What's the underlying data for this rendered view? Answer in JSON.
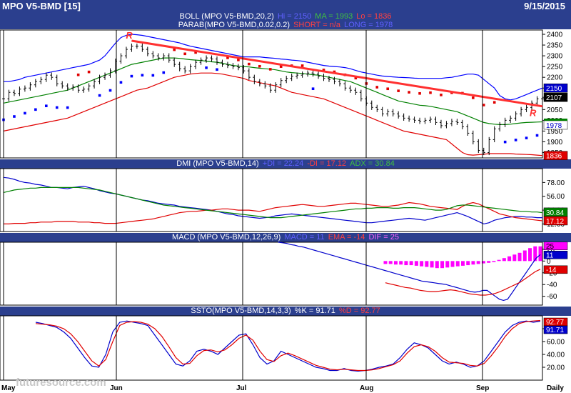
{
  "header": {
    "symbol": "MPO V5-BMD [15]",
    "date": "9/15/2015"
  },
  "panels": {
    "price": {
      "boll_label": "BOLL (MPO V5-BMD,20,2)",
      "boll_hi": "Hi = 2150",
      "boll_ma": "MA = 1993",
      "boll_lo": "Lo = 1836",
      "parab_label": "PARAB(MPO V5-BMD,0.02,0.2)",
      "parab_short": "SHORT = n/a",
      "parab_long": "LONG = 1978",
      "yticks": [
        "2400",
        "2350",
        "2300",
        "2250",
        "2200",
        "2150",
        "2100",
        "2050",
        "2000",
        "1950",
        "1900",
        "1850"
      ],
      "last_labels": {
        "hi": "2150",
        "close": "2107",
        "ma": "1978",
        "lo": "1836"
      },
      "annotations": [
        "R",
        "R"
      ]
    },
    "dmi": {
      "label": "DMI (MPO V5-BMD,14)",
      "plus": "+DI = 22.24",
      "minus": "-DI = 17.12",
      "adx": "ADX = 30.84",
      "yticks": [
        "78.00",
        "56.00",
        "34.00",
        "12.00"
      ],
      "last_labels": {
        "adx": "30.84",
        "minus": "17.12"
      }
    },
    "macd": {
      "label": "MACD (MPO V5-BMD,12,26,9)",
      "macd": "MACD = 11",
      "ema": "EMA = -14",
      "dif": "DIF = 25",
      "yticks": [
        "20",
        "0",
        "-20",
        "-40",
        "-60"
      ],
      "last_labels": {
        "dif": "25",
        "macd": "11",
        "ema": "-14"
      }
    },
    "ssto": {
      "label": "SSTO(MPO V5-BMD,14,3,3)",
      "k": "%K = 91.71",
      "d": "%D = 92.77",
      "yticks": [
        "80.00",
        "60.00",
        "40.00",
        "20.00"
      ],
      "last_labels": {
        "d": "92.77",
        "k": "91.71"
      }
    }
  },
  "xaxis": {
    "labels": [
      "May",
      "Jun",
      "Jul",
      "Aug",
      "Sep",
      "Daily"
    ]
  },
  "watermark": "futuresource.com",
  "colors": {
    "header": "#2b3f8e",
    "bollUpper": "#0000ff",
    "bollLower": "#e00000",
    "bollMA": "#008000",
    "sarLong": "#0000ff",
    "sarShort": "#e00000",
    "trendline": "#ff3030",
    "bars": "#000000",
    "macdHist": "#ff00ff"
  },
  "chart_data": [
    {
      "type": "line",
      "panel": "price",
      "ylim": [
        1825,
        2420
      ],
      "note_series": [
        "Close",
        "BOLL Hi",
        "BOLL MA",
        "BOLL Lo"
      ],
      "xlabels": [
        "May",
        "Jun",
        "Jul",
        "Aug",
        "Sep"
      ],
      "close": [
        2100,
        2130,
        2125,
        2145,
        2150,
        2165,
        2180,
        2190,
        2210,
        2200,
        2170,
        2160,
        2150,
        2155,
        2140,
        2145,
        2160,
        2180,
        2200,
        2210,
        2230,
        2275,
        2300,
        2330,
        2345,
        2345,
        2330,
        2310,
        2300,
        2290,
        2300,
        2280,
        2260,
        2240,
        2230,
        2250,
        2270,
        2280,
        2290,
        2285,
        2270,
        2260,
        2255,
        2250,
        2245,
        2230,
        2200,
        2180,
        2170,
        2160,
        2140,
        2165,
        2185,
        2195,
        2205,
        2210,
        2215,
        2220,
        2215,
        2205,
        2195,
        2190,
        2180,
        2170,
        2150,
        2140,
        2130,
        2100,
        2080,
        2060,
        2050,
        2030,
        2040,
        2030,
        2020,
        2010,
        2005,
        2000,
        1995,
        2000,
        2005,
        1990,
        1975,
        1985,
        1995,
        1990,
        1970,
        1940,
        1900,
        1860,
        1850,
        1910,
        1960,
        1980,
        2000,
        2010,
        2030,
        2050,
        2060,
        2080,
        2100,
        2107
      ],
      "bollHi": [
        2180,
        2180,
        2185,
        2190,
        2200,
        2205,
        2210,
        2215,
        2220,
        2225,
        2230,
        2235,
        2240,
        2245,
        2250,
        2255,
        2260,
        2270,
        2280,
        2300,
        2330,
        2360,
        2385,
        2395,
        2400,
        2398,
        2395,
        2390,
        2385,
        2380,
        2375,
        2370,
        2365,
        2360,
        2352,
        2345,
        2340,
        2335,
        2330,
        2325,
        2320,
        2315,
        2310,
        2305,
        2300,
        2295,
        2295,
        2295,
        2295,
        2292,
        2290,
        2288,
        2285,
        2283,
        2280,
        2278,
        2275,
        2270,
        2265,
        2260,
        2255,
        2252,
        2250,
        2248,
        2245,
        2240,
        2232,
        2225,
        2220,
        2215,
        2210,
        2206,
        2204,
        2202,
        2200,
        2199,
        2198,
        2196,
        2195,
        2195,
        2195,
        2195,
        2195,
        2198,
        2200,
        2205,
        2210,
        2215,
        2215,
        2210,
        2190,
        2170,
        2150,
        2115,
        2100,
        2095,
        2100,
        2110,
        2120,
        2130,
        2140,
        2150
      ],
      "bollMA": [
        2080,
        2085,
        2090,
        2095,
        2100,
        2105,
        2110,
        2115,
        2120,
        2125,
        2130,
        2135,
        2140,
        2150,
        2160,
        2170,
        2180,
        2190,
        2200,
        2210,
        2220,
        2230,
        2240,
        2250,
        2260,
        2265,
        2270,
        2275,
        2280,
        2285,
        2290,
        2290,
        2290,
        2288,
        2285,
        2282,
        2280,
        2278,
        2275,
        2272,
        2270,
        2265,
        2260,
        2255,
        2252,
        2250,
        2248,
        2245,
        2242,
        2240,
        2238,
        2235,
        2230,
        2225,
        2222,
        2220,
        2218,
        2215,
        2212,
        2210,
        2205,
        2200,
        2195,
        2190,
        2185,
        2180,
        2170,
        2160,
        2150,
        2140,
        2130,
        2120,
        2110,
        2100,
        2090,
        2085,
        2080,
        2075,
        2070,
        2068,
        2065,
        2060,
        2055,
        2050,
        2045,
        2040,
        2030,
        2020,
        2010,
        2000,
        1990,
        1985,
        1982,
        1980,
        1980,
        1982,
        1985,
        1988,
        1990,
        1991,
        1992,
        1993
      ],
      "bollLo": [
        1950,
        1955,
        1960,
        1965,
        1970,
        1975,
        1980,
        1985,
        1990,
        1995,
        2000,
        2005,
        2010,
        2020,
        2030,
        2040,
        2050,
        2060,
        2070,
        2080,
        2090,
        2100,
        2110,
        2120,
        2130,
        2140,
        2145,
        2150,
        2160,
        2170,
        2180,
        2190,
        2200,
        2205,
        2210,
        2215,
        2218,
        2220,
        2220,
        2220,
        2218,
        2215,
        2210,
        2205,
        2200,
        2195,
        2185,
        2180,
        2175,
        2170,
        2165,
        2160,
        2150,
        2140,
        2130,
        2125,
        2120,
        2115,
        2110,
        2105,
        2100,
        2090,
        2080,
        2070,
        2060,
        2050,
        2040,
        2030,
        2020,
        2010,
        2000,
        1990,
        1980,
        1970,
        1960,
        1950,
        1945,
        1940,
        1935,
        1930,
        1925,
        1920,
        1915,
        1910,
        1890,
        1870,
        1850,
        1840,
        1838,
        1840,
        1842,
        1845,
        1845,
        1845,
        1845,
        1845,
        1843,
        1842,
        1841,
        1840,
        1838,
        1836
      ]
    },
    {
      "type": "line",
      "panel": "dmi",
      "ylim": [
        0,
        100
      ],
      "series": [
        {
          "name": "+DI",
          "values": [
            86,
            85,
            83,
            80,
            78,
            77,
            75,
            74,
            72,
            70,
            70,
            69,
            68,
            70,
            71,
            72,
            70,
            68,
            65,
            63,
            61,
            60,
            58,
            56,
            54,
            52,
            50,
            49,
            47,
            45,
            44,
            43,
            42,
            40,
            39,
            38,
            37,
            36,
            35,
            34,
            32,
            30,
            28,
            27,
            25,
            24,
            23,
            22,
            21,
            22,
            23,
            25,
            26,
            27,
            28,
            27,
            26,
            25,
            24,
            23,
            22,
            21,
            20,
            19,
            18,
            17,
            16,
            15,
            14,
            14,
            15,
            16,
            17,
            18,
            19,
            20,
            21,
            20,
            19,
            18,
            20,
            22,
            24,
            26,
            28,
            30,
            27,
            24,
            20,
            16,
            12,
            14,
            18,
            20,
            22,
            23,
            24,
            24,
            23,
            23,
            22,
            22
          ]
        },
        {
          "name": "-DI",
          "values": [
            12,
            12,
            13,
            13,
            13,
            14,
            14,
            15,
            15,
            15,
            16,
            16,
            16,
            16,
            15,
            15,
            15,
            14,
            14,
            13,
            13,
            13,
            14,
            15,
            16,
            17,
            18,
            19,
            20,
            22,
            24,
            26,
            28,
            30,
            31,
            32,
            32,
            33,
            34,
            34,
            35,
            36,
            36,
            35,
            34,
            34,
            34,
            33,
            32,
            34,
            36,
            38,
            39,
            40,
            41,
            42,
            43,
            42,
            41,
            40,
            40,
            41,
            42,
            43,
            44,
            45,
            45,
            44,
            43,
            42,
            41,
            40,
            40,
            41,
            42,
            44,
            46,
            45,
            44,
            42,
            40,
            39,
            38,
            37,
            36,
            35,
            40,
            44,
            46,
            44,
            40,
            36,
            32,
            28,
            26,
            24,
            22,
            21,
            20,
            19,
            18,
            17
          ]
        },
        {
          "name": "ADX",
          "values": [
            62,
            64,
            66,
            67,
            68,
            69,
            69,
            70,
            70,
            70,
            70,
            70,
            70,
            70,
            70,
            69,
            68,
            67,
            66,
            64,
            62,
            60,
            58,
            56,
            54,
            52,
            50,
            48,
            46,
            44,
            42,
            41,
            40,
            39,
            38,
            37,
            36,
            35,
            34,
            33,
            32,
            31,
            30,
            29,
            28,
            27,
            26,
            25,
            24,
            23,
            22,
            22,
            22,
            23,
            24,
            25,
            26,
            27,
            28,
            29,
            30,
            31,
            32,
            33,
            34,
            35,
            36,
            36,
            37,
            37,
            38,
            38,
            38,
            37,
            37,
            38,
            38,
            38,
            37,
            36,
            35,
            34,
            34,
            35,
            38,
            41,
            42,
            42,
            41,
            40,
            39,
            38,
            37,
            36,
            35,
            34,
            33,
            32,
            32,
            31,
            31,
            30
          ]
        }
      ]
    },
    {
      "type": "line",
      "panel": "macd",
      "ylim": [
        -75,
        32
      ],
      "series": [
        {
          "name": "DIF",
          "values": [
            -5,
            -5,
            -6,
            -6,
            -7,
            -7,
            -8,
            -9,
            -10,
            -11,
            -12,
            -12,
            -11,
            -10,
            -9,
            -8,
            -7,
            -6,
            -5,
            -4,
            -3,
            0,
            2,
            5,
            8,
            11,
            14,
            18,
            22,
            25,
            25
          ]
        },
        {
          "name": "MACD",
          "values": [
            32,
            31,
            30,
            28,
            27,
            25,
            24,
            22,
            20,
            18,
            16,
            14,
            12,
            10,
            8,
            6,
            4,
            2,
            0,
            -2,
            -4,
            -6,
            -8,
            -10,
            -12,
            -14,
            -16,
            -18,
            -20,
            -22,
            -24,
            -26,
            -28,
            -30,
            -32,
            -34,
            -35,
            -36,
            -37,
            -38,
            -39,
            -40,
            -42,
            -44,
            -46,
            -48,
            -50,
            -52,
            -53,
            -52,
            -50,
            -50,
            -55,
            -60,
            -65,
            -67,
            -65,
            -55,
            -45,
            -35,
            -25,
            -15,
            -5,
            5,
            11
          ]
        },
        {
          "name": "EMA",
          "values": [
            -37,
            -39,
            -41,
            -43,
            -45,
            -46,
            -48,
            -50,
            -51,
            -52,
            -52,
            -51,
            -50,
            -49,
            -50,
            -52,
            -54,
            -56,
            -57,
            -58,
            -58,
            -57,
            -55,
            -52,
            -48,
            -44,
            -40,
            -36,
            -30,
            -24,
            -18,
            -14
          ]
        }
      ]
    },
    {
      "type": "line",
      "panel": "ssto",
      "ylim": [
        0,
        100
      ],
      "series": [
        {
          "name": "%K",
          "values": [
            90,
            88,
            85,
            82,
            75,
            65,
            50,
            35,
            22,
            20,
            40,
            75,
            90,
            92,
            90,
            88,
            85,
            70,
            55,
            40,
            25,
            22,
            30,
            45,
            48,
            45,
            40,
            50,
            60,
            70,
            72,
            55,
            35,
            25,
            30,
            45,
            40,
            35,
            30,
            25,
            20,
            18,
            15,
            15,
            18,
            15,
            14,
            15,
            17,
            20,
            22,
            25,
            35,
            48,
            58,
            55,
            50,
            40,
            30,
            25,
            28,
            25,
            20,
            22,
            30,
            45,
            60,
            75,
            85,
            90,
            92,
            90,
            91.71
          ]
        },
        {
          "name": "%D",
          "values": [
            88,
            87,
            86,
            84,
            80,
            72,
            60,
            45,
            30,
            22,
            32,
            60,
            85,
            90,
            91,
            90,
            87,
            80,
            68,
            52,
            35,
            25,
            26,
            38,
            46,
            47,
            44,
            47,
            55,
            65,
            70,
            62,
            45,
            32,
            29,
            38,
            42,
            38,
            33,
            28,
            23,
            20,
            17,
            16,
            17,
            16,
            15,
            15,
            16,
            18,
            21,
            24,
            30,
            42,
            52,
            55,
            52,
            45,
            35,
            28,
            27,
            26,
            23,
            22,
            26,
            38,
            52,
            68,
            80,
            88,
            91,
            92,
            92.77
          ]
        }
      ]
    }
  ]
}
